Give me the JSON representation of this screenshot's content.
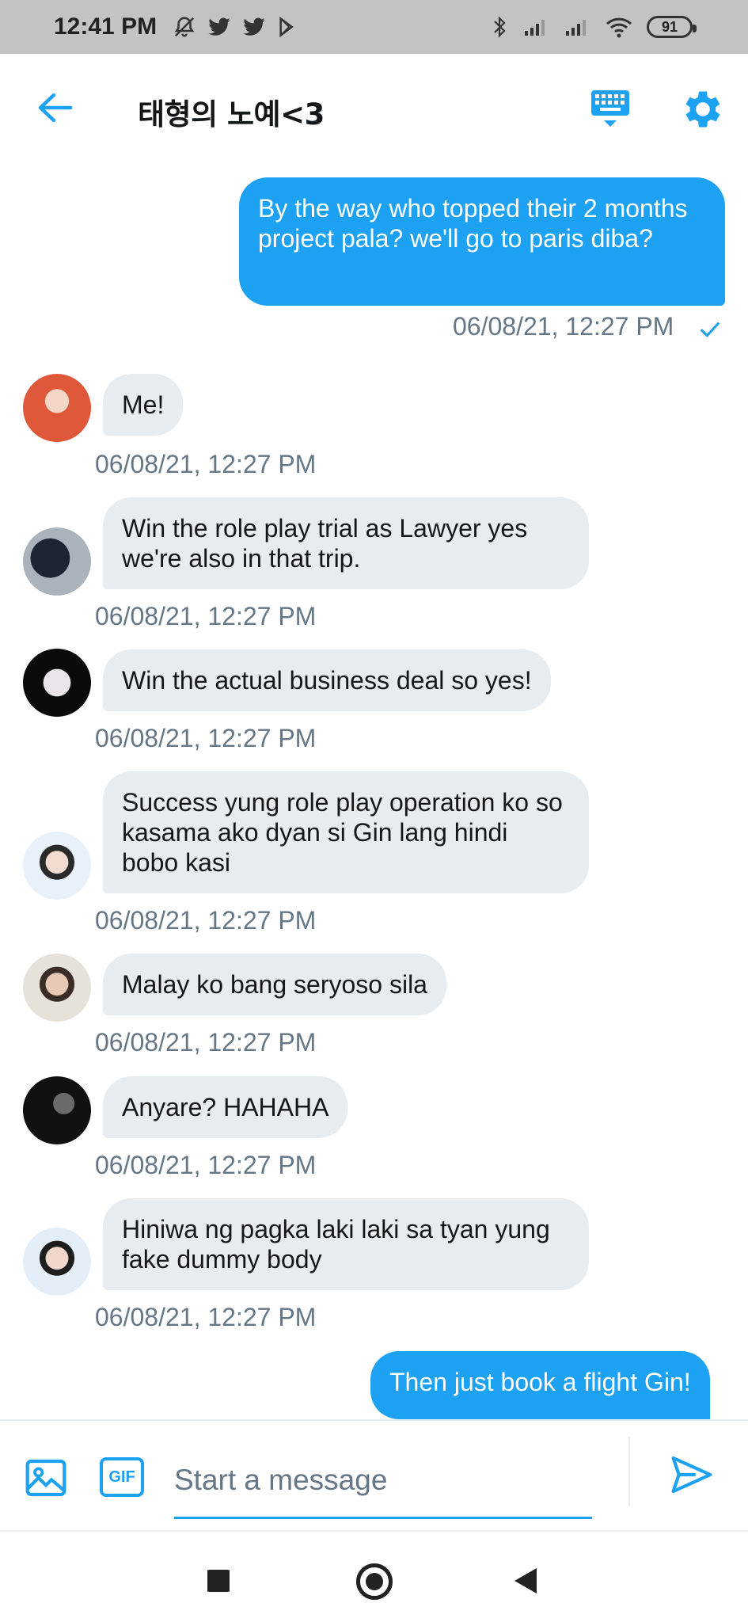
{
  "status_bar": {
    "time": "12:41 PM",
    "battery": "91",
    "icons_left": [
      "mute-notification-icon",
      "twitter-icon",
      "twitter-icon",
      "play-store-icon"
    ],
    "icons_right": [
      "bluetooth-icon",
      "signal-icon",
      "signal-icon",
      "wifi-icon",
      "battery-icon"
    ]
  },
  "header": {
    "title": "태형의 노예<3",
    "back_icon": "arrow-left-icon",
    "keyboard_icon": "keyboard-icon",
    "settings_icon": "gear-icon",
    "accent": "#1da1f2"
  },
  "messages": [
    {
      "direction": "out",
      "text": "By the way who topped their 2 months project pala? we'll go to paris diba?",
      "timestamp": "06/08/21, 12:27 PM",
      "read": true
    },
    {
      "direction": "in",
      "text": "Me!",
      "timestamp": "06/08/21, 12:27 PM",
      "avatar": "avatar-orange"
    },
    {
      "direction": "in",
      "text": "Win the role play trial as Lawyer yes we're also in that trip.",
      "timestamp": "06/08/21, 12:27 PM",
      "avatar": "avatar-dark-room"
    },
    {
      "direction": "in",
      "text": "Win the actual business deal so yes!",
      "timestamp": "06/08/21, 12:27 PM",
      "avatar": "avatar-black"
    },
    {
      "direction": "in",
      "text": "Success yung role play operation ko so kasama ako dyan si Gin lang hindi bobo kasi",
      "timestamp": "06/08/21, 12:27 PM",
      "avatar": "avatar-light-blue"
    },
    {
      "direction": "in",
      "text": "Malay ko bang seryoso sila",
      "timestamp": "06/08/21, 12:27 PM",
      "avatar": "avatar-beige"
    },
    {
      "direction": "in",
      "text": "Anyare? HAHAHA",
      "timestamp": "06/08/21, 12:27 PM",
      "avatar": "avatar-dark"
    },
    {
      "direction": "in",
      "text": "Hiniwa ng pagka laki laki sa tyan yung fake dummy body",
      "timestamp": "06/08/21, 12:27 PM",
      "avatar": "avatar-light-blue-2"
    },
    {
      "direction": "out",
      "text": "Then just book a flight Gin!",
      "timestamp": "",
      "read": false
    }
  ],
  "composer": {
    "placeholder": "Start a message",
    "gif_label": "GIF",
    "image_icon": "image-icon",
    "send_icon": "send-icon"
  },
  "nav_bar": {
    "icons": [
      "recent-apps-icon",
      "home-icon",
      "back-icon"
    ]
  },
  "colors": {
    "outgoing_bubble": "#1da1f2",
    "incoming_bubble": "#e6ecf0",
    "timestamp": "#657786",
    "status_bar": "#c3c3c3"
  }
}
